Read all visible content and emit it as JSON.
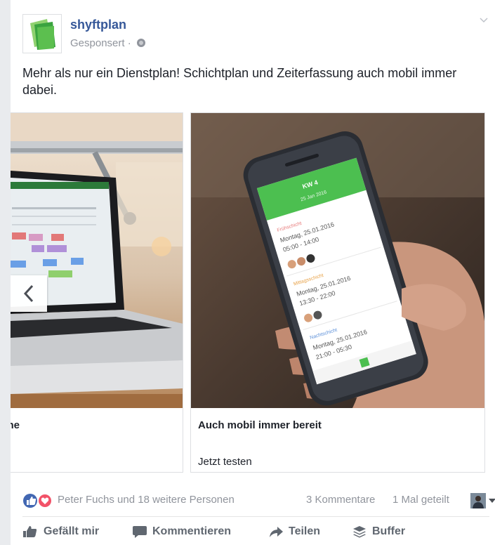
{
  "post": {
    "page_name": "shyftplan",
    "sponsored_label": "Gesponsert ·",
    "text": "Mehr als nur ein Dienstplan! Schichtplan und Zeiterfassung auch mobil immer dabei."
  },
  "carousel": {
    "cards": [
      {
        "title": "ne",
        "cta": ""
      },
      {
        "title": "Auch mobil immer bereit",
        "cta": "Jetzt testen"
      }
    ],
    "phone_screen": {
      "header_title": "KW 4",
      "header_sub": "25 Jan 2016",
      "shifts": [
        {
          "label": "Frühschicht",
          "date": "Montag, 25.01.2016",
          "time": "05:00 - 14:00",
          "color": "#e87b7b"
        },
        {
          "label": "Mittagsschicht",
          "date": "Montag, 25.01.2016",
          "time": "13:30 - 22:00",
          "color": "#e8a34a"
        },
        {
          "label": "Nachtschicht",
          "date": "Montag, 25.01.2016",
          "time": "21:00 - 05:30",
          "color": "#5b8fd8"
        }
      ]
    }
  },
  "reactions": {
    "names": "Peter Fuchs und 18 weitere Personen",
    "comments": "3 Kommentare",
    "shares": "1 Mal geteilt"
  },
  "actions": {
    "like": "Gefällt mir",
    "comment": "Kommentieren",
    "share": "Teilen",
    "buffer": "Buffer"
  },
  "colors": {
    "brand_green": "#48b04a",
    "link_blue": "#365899",
    "like_blue": "#4267b2",
    "love_red": "#f25268"
  }
}
